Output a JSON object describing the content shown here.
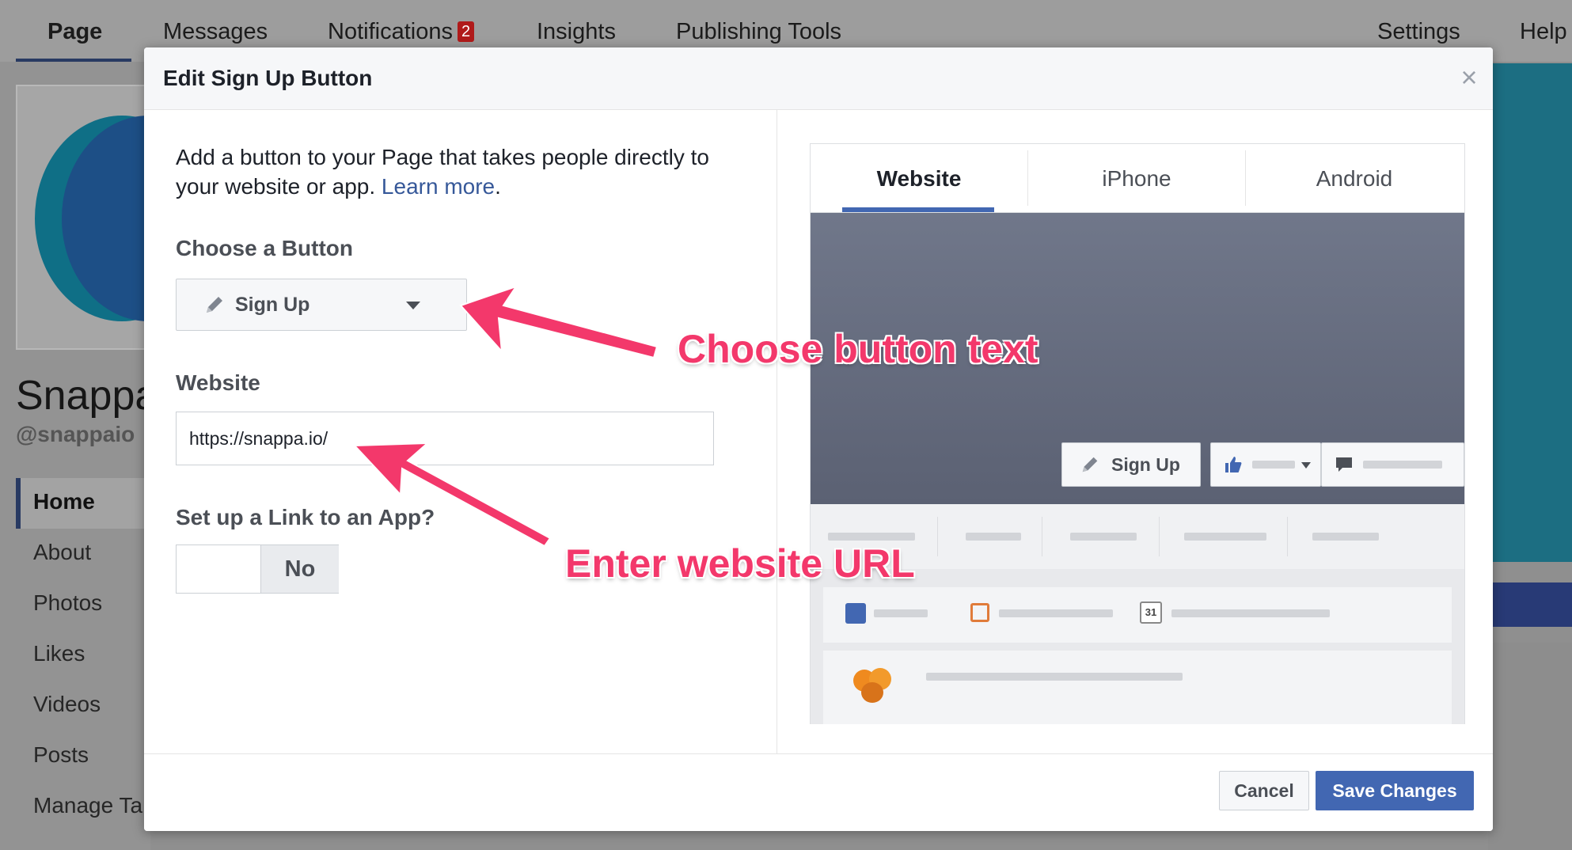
{
  "topnav": {
    "items": [
      "Page",
      "Messages",
      "Notifications",
      "Insights",
      "Publishing Tools",
      "Settings",
      "Help"
    ],
    "notifications_badge": "2"
  },
  "profile": {
    "name": "Snappa",
    "handle": "@snappaio",
    "sidebar": [
      "Home",
      "About",
      "Photos",
      "Likes",
      "Videos",
      "Posts",
      "Manage Ta"
    ]
  },
  "modal": {
    "title": "Edit Sign Up Button",
    "close_icon": "close-icon",
    "intro_text": "Add a button to your Page that takes people directly to your website or app.",
    "learn_more": "Learn more",
    "period": ".",
    "choose_button_label": "Choose a Button",
    "button_choice": "Sign Up",
    "website_label": "Website",
    "website_value": "https://snappa.io/",
    "app_link_label": "Set up a Link to an App?",
    "app_link_toggle": "No",
    "cancel": "Cancel",
    "save": "Save Changes"
  },
  "preview": {
    "tabs": [
      "Website",
      "iPhone",
      "Android"
    ],
    "active_tab": "Website",
    "button_label": "Sign Up",
    "calendar_day": "31"
  },
  "annotations": {
    "choose_text": "Choose button text",
    "enter_url": "Enter website URL"
  },
  "colors": {
    "accent": "#4267b2",
    "annotation": "#f3386b",
    "link": "#365899"
  }
}
